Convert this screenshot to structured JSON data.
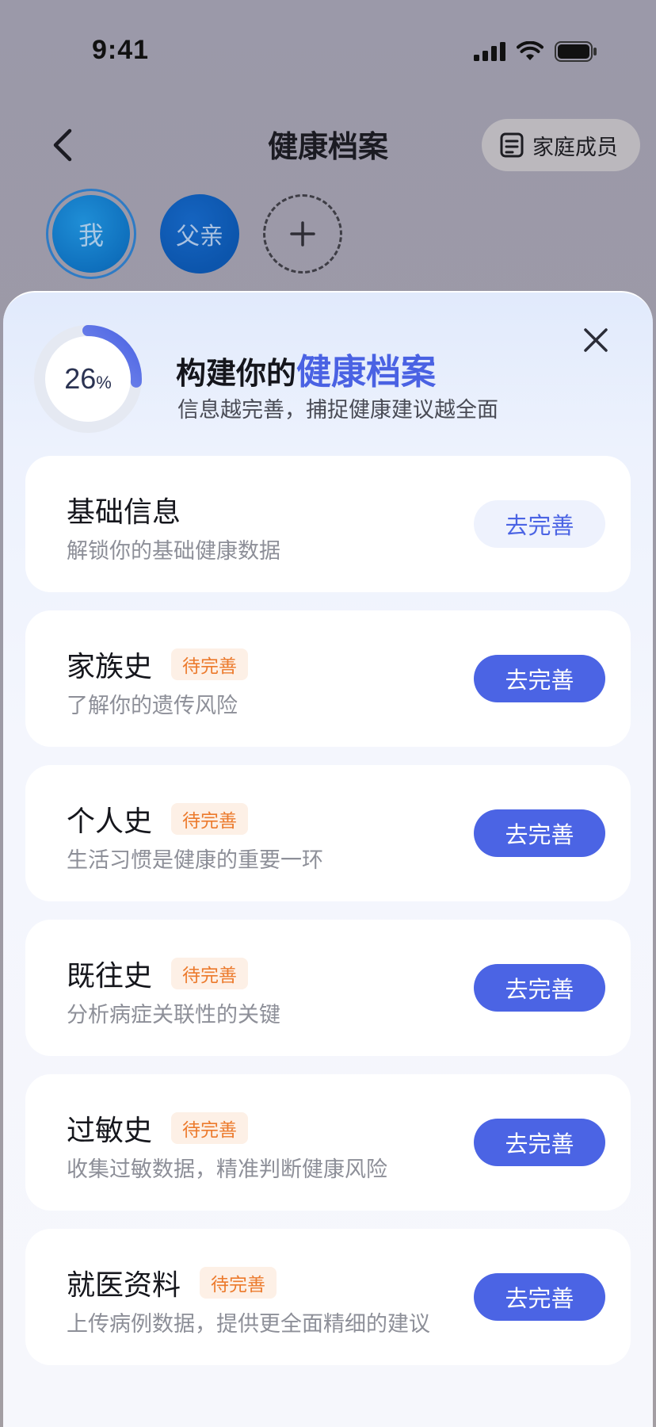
{
  "status_bar": {
    "time": "9:41"
  },
  "header": {
    "title": "健康档案",
    "family_button": "家庭成员"
  },
  "members": [
    {
      "label": "我",
      "selected": true
    },
    {
      "label": "父亲",
      "selected": false
    }
  ],
  "sheet": {
    "progress": {
      "value": 26,
      "unit": "%"
    },
    "title_prefix": "构建你的",
    "title_highlight": "健康档案",
    "subtitle": "信息越完善，捕捉健康建议越全面"
  },
  "cards": [
    {
      "title": "基础信息",
      "badge": "",
      "desc": "解锁你的基础健康数据",
      "button": "去完善",
      "button_style": "light"
    },
    {
      "title": "家族史",
      "badge": "待完善",
      "desc": "了解你的遗传风险",
      "button": "去完善",
      "button_style": "primary"
    },
    {
      "title": "个人史",
      "badge": "待完善",
      "desc": "生活习惯是健康的重要一环",
      "button": "去完善",
      "button_style": "primary"
    },
    {
      "title": "既往史",
      "badge": "待完善",
      "desc": "分析病症关联性的关键",
      "button": "去完善",
      "button_style": "primary"
    },
    {
      "title": "过敏史",
      "badge": "待完善",
      "desc": "收集过敏数据，精准判断健康风险",
      "button": "去完善",
      "button_style": "primary"
    },
    {
      "title": "就医资料",
      "badge": "待完善",
      "desc": "上传病例数据，提供更全面精细的建议",
      "button": "去完善",
      "button_style": "primary"
    }
  ],
  "colors": {
    "accent": "#4b64e4",
    "badge_text": "#ec7a2c",
    "badge_bg": "#fdf0e6"
  },
  "icons": [
    "back-icon",
    "clipboard-icon",
    "add-icon",
    "close-icon",
    "signal-icon",
    "wifi-icon",
    "battery-icon"
  ]
}
